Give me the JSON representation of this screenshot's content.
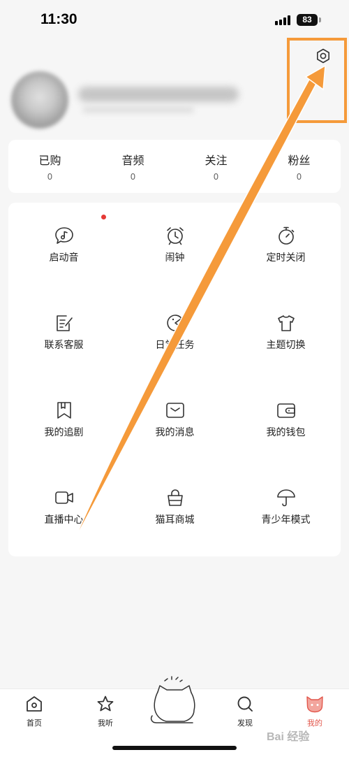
{
  "status_bar": {
    "time": "11:30",
    "battery": "83"
  },
  "stats": [
    {
      "label": "已购",
      "value": "0"
    },
    {
      "label": "音频",
      "value": "0"
    },
    {
      "label": "关注",
      "value": "0"
    },
    {
      "label": "粉丝",
      "value": "0"
    }
  ],
  "grid": [
    {
      "label": "启动音",
      "icon": "music-bubble-icon"
    },
    {
      "label": "闹钟",
      "icon": "alarm-clock-icon"
    },
    {
      "label": "定时关闭",
      "icon": "stopwatch-icon"
    },
    {
      "label": "联系客服",
      "icon": "edit-note-icon"
    },
    {
      "label": "日常任务",
      "icon": "pacman-icon"
    },
    {
      "label": "主题切换",
      "icon": "tshirt-icon"
    },
    {
      "label": "我的追剧",
      "icon": "bookmark-icon"
    },
    {
      "label": "我的消息",
      "icon": "message-box-icon"
    },
    {
      "label": "我的钱包",
      "icon": "wallet-icon"
    },
    {
      "label": "直播中心",
      "icon": "video-camera-icon"
    },
    {
      "label": "猫耳商城",
      "icon": "shopping-bag-icon"
    },
    {
      "label": "青少年模式",
      "icon": "umbrella-icon"
    }
  ],
  "nav": {
    "home": "首页",
    "listen": "我听",
    "discover": "发现",
    "mine": "我的"
  },
  "watermark": "Bai 经验",
  "colors": {
    "accent": "#e2574c",
    "annotation": "#f59a3a",
    "badge": "#e53935"
  }
}
